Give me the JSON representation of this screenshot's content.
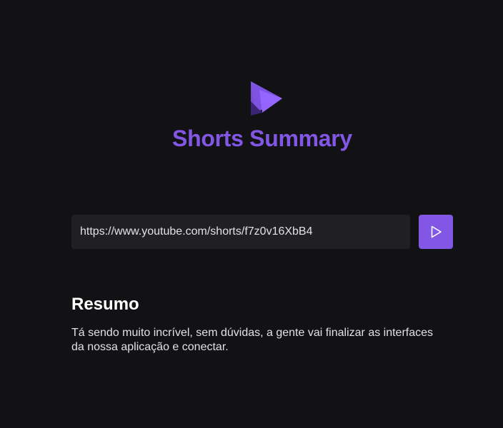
{
  "app": {
    "title": "Shorts Summary",
    "logo_icon": "play-logo-icon"
  },
  "form": {
    "url_value": "https://www.youtube.com/shorts/f7z0v16XbB4",
    "submit_icon": "play-icon"
  },
  "summary": {
    "heading": "Resumo",
    "text": "Tá sendo muito incrível, sem dúvidas, a gente vai finalizar as interfaces da nossa aplicação e conectar."
  },
  "colors": {
    "background": "#121214",
    "accent": "#8257e5",
    "input_background": "#202024",
    "text": "#e1e1e6"
  }
}
